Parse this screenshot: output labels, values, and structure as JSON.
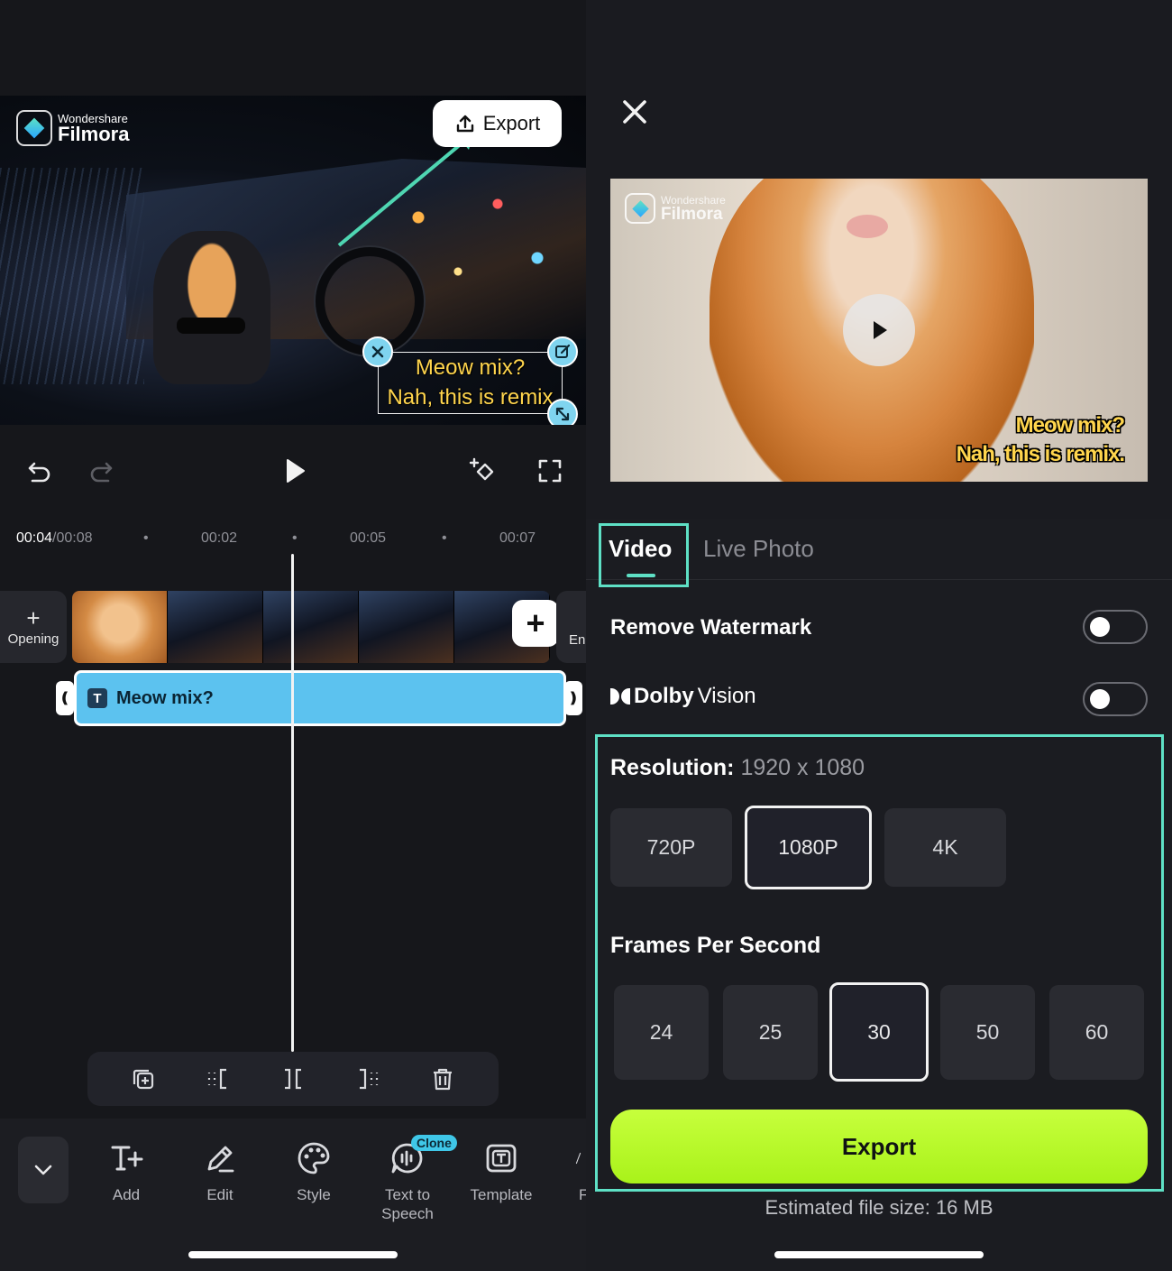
{
  "editor": {
    "brand_small": "Wondershare",
    "brand_big": "Filmora",
    "export_label": "Export",
    "text_overlay": [
      "Meow mix?",
      "Nah, this is remix"
    ],
    "timeline": {
      "current": "00:04",
      "total": "/00:08",
      "ticks": [
        "00:02",
        "00:05",
        "00:07"
      ],
      "dots": [
        "•",
        "•",
        "•"
      ]
    },
    "opening_label": "Opening",
    "opening_plus": "+",
    "ending_label": "En",
    "add_clip": "+",
    "text_clip_icon": "T",
    "text_clip_label": "Meow mix?",
    "track_handle_left": "❪",
    "track_handle_right": "❫",
    "tools": [
      {
        "label": "Add",
        "icon": "add-text-icon"
      },
      {
        "label": "Edit",
        "icon": "pencil-icon"
      },
      {
        "label": "Style",
        "icon": "palette-icon"
      },
      {
        "label": "Text to Speech",
        "icon": "speech-icon"
      },
      {
        "label": "Template",
        "icon": "template-icon"
      },
      {
        "label": "F",
        "icon": "font-icon"
      }
    ],
    "clone_badge": "Clone",
    "accent": "#5ee0c5"
  },
  "export_panel": {
    "preview_brand_small": "Wondershare",
    "preview_brand_big": "Filmora",
    "preview_caption": [
      "Meow mix?",
      "Nah, this is remix."
    ],
    "tabs": [
      {
        "label": "Video",
        "active": true
      },
      {
        "label": "Live Photo",
        "active": false
      }
    ],
    "remove_watermark_label": "Remove Watermark",
    "dolby_word": "Dolby",
    "dolby_suffix": "Vision",
    "resolution_label": "Resolution:",
    "resolution_value": "1920 x 1080",
    "resolutions": [
      "720P",
      "1080P",
      "4K"
    ],
    "resolution_selected": "1080P",
    "fps_label": "Frames Per Second",
    "fps_options": [
      "24",
      "25",
      "30",
      "50",
      "60"
    ],
    "fps_selected": "30",
    "export_button": "Export",
    "estimated_size": "Estimated file size: 16 MB",
    "export_color": "#b4f72a"
  }
}
